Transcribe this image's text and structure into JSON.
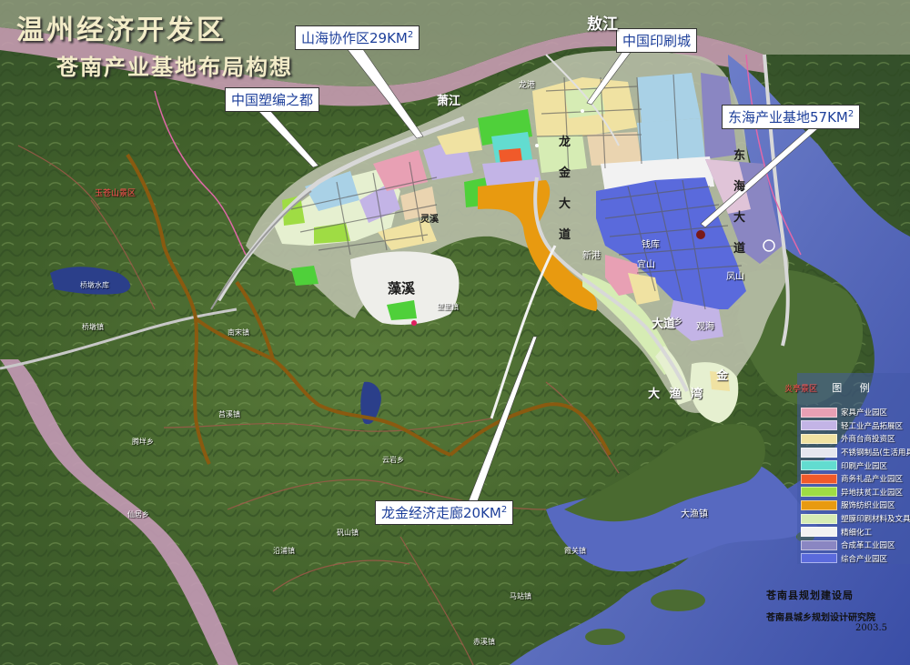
{
  "title": {
    "line1": "温州经济开发区",
    "line2": "苍南产业基地布局构想"
  },
  "callouts": {
    "shanhai_prefix": "山海协作区29KM",
    "donghai_prefix": "东海产业基地57KM",
    "longjin_prefix": "龙金经济走廊20KM",
    "exponent": "2",
    "suobian": "中国塑编之都",
    "yinshua": "中国印刷城"
  },
  "place_labels": {
    "aojiang": "敖江",
    "xiaojiang": "萧江",
    "zaoxi": "藻溪",
    "xingang": "新港",
    "dayuwan": "大 渔 湾",
    "dayuzhen": "大渔镇",
    "lingxi": "灵溪",
    "jinxiang": "金",
    "qianku": "钱库",
    "yishan": "宜山",
    "jinxiang2": "金乡",
    "guanhai": "观海",
    "fengshan": "凤山",
    "datong": "大道",
    "longjin_road": "龙 金 大 道",
    "east_road": "东 海 大 道",
    "reservoir": "桥墩水库",
    "north_scenic": "玉苍山景区",
    "east_scenic": "炎亭景区",
    "zhen1": "龙港",
    "zhen2": "望里镇",
    "zhen3": "马站镇",
    "zhen4": "赤溪镇",
    "zhen5": "霞关镇",
    "zhen6": "沿浦镇",
    "zhen7": "桥墩镇",
    "zhen8": "矾山镇",
    "zhen9": "南宋镇",
    "zhen10": "莒溪镇",
    "zhen11": "腾垟乡",
    "zhen12": "仙居乡",
    "zhen13": "云岩乡"
  },
  "legend": {
    "title": "图  例",
    "items": [
      {
        "label": "家具产业园区",
        "color": "#e8a0b4"
      },
      {
        "label": "轻工业产品拓展区",
        "color": "#c3b4e6"
      },
      {
        "label": "外商台商投资区",
        "color": "#f0e2a2"
      },
      {
        "label": "不锈钢制品(生活用具)",
        "color": "#e6e6ef"
      },
      {
        "label": "印刷产业园区",
        "color": "#62dcd0"
      },
      {
        "label": "商务礼品产业园区",
        "color": "#f05a2a"
      },
      {
        "label": "异地扶贫工业园区",
        "color": "#9fdc44"
      },
      {
        "label": "服饰纺织业园区",
        "color": "#e89a10"
      },
      {
        "label": "塑膜印刷材料及文具用品",
        "color": "#d6ecb4"
      },
      {
        "label": "精细化工",
        "color": "#f2f2f2"
      },
      {
        "label": "合成革工业园区",
        "color": "#8a86c2"
      },
      {
        "label": "综合产业园区",
        "color": "#5a6adc"
      }
    ]
  },
  "credits": {
    "bureau": "苍南县规划建设局",
    "institute": "苍南县城乡规划设计研究院",
    "date": "2003.5"
  },
  "colors": {
    "sea": "#4a5fb4",
    "river_band": "#b98fa6",
    "boundary_brown": "#8a5a10",
    "terrain": "#3f5f2c",
    "terrain_light": "#5f7f3e"
  }
}
